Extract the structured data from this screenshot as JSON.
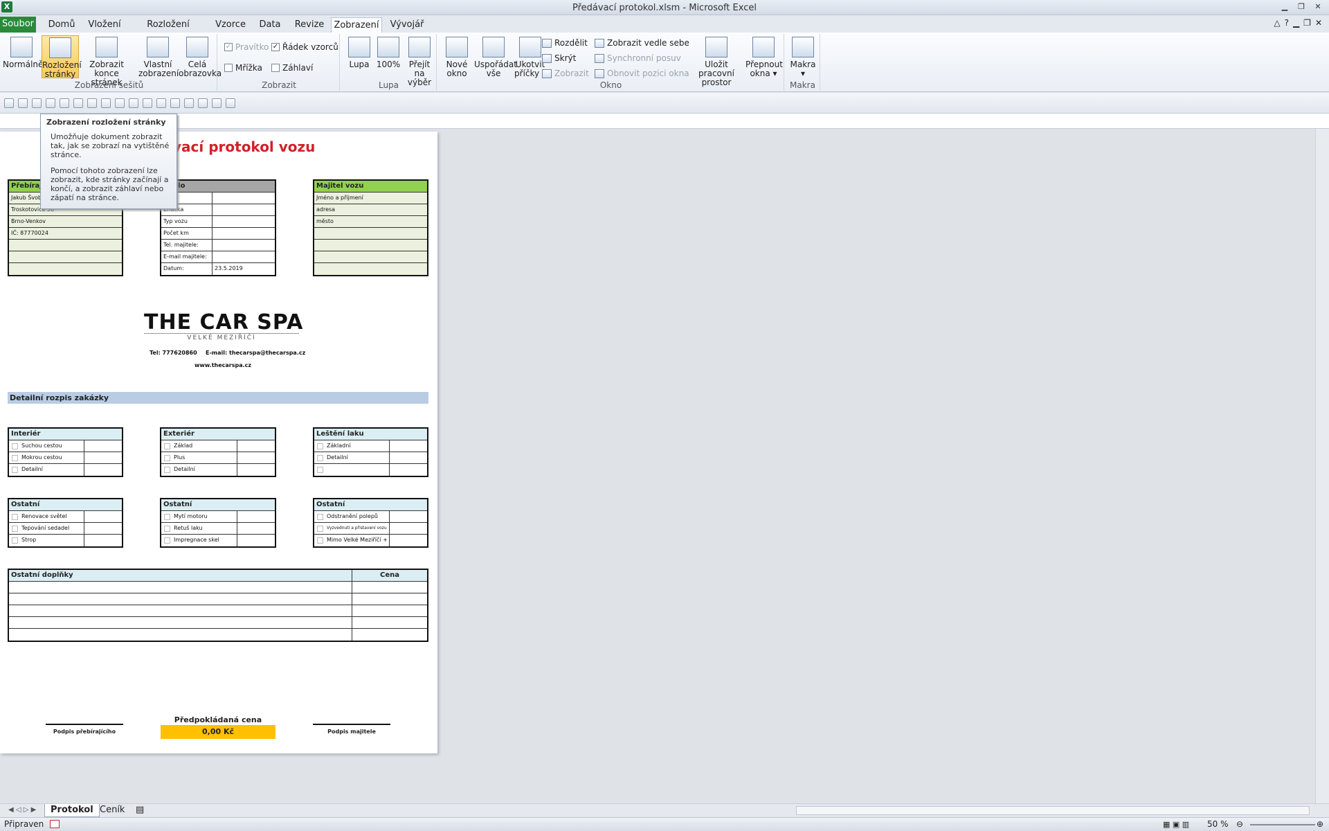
{
  "window": {
    "title": "Předávací protokol.xlsm - Microsoft Excel",
    "app_icon": "X"
  },
  "tabs": [
    "Soubor",
    "Domů",
    "Vložení",
    "Rozložení stránky",
    "Vzorce",
    "Data",
    "Revize",
    "Zobrazení",
    "Vývojář"
  ],
  "ribbon": {
    "workbook_views": {
      "label": "Zobrazení sešitů",
      "normal": "Normálně",
      "page_layout_1": "Rozložení",
      "page_layout_2": "stránky",
      "page_break_1": "Zobrazit",
      "page_break_2": "konce stránek",
      "custom_1": "Vlastní",
      "custom_2": "zobrazení",
      "full_1": "Celá",
      "full_2": "obrazovka"
    },
    "show": {
      "label": "Zobrazit",
      "ruler": "Pravítko",
      "formula_bar": "Řádek vzorců",
      "gridlines": "Mřížka",
      "headings": "Záhlaví"
    },
    "zoom": {
      "label": "Lupa",
      "zoom": "Lupa",
      "hundred": "100%",
      "sel_1": "Přejít na",
      "sel_2": "výběr"
    },
    "window": {
      "label": "Okno",
      "new_1": "Nové",
      "new_2": "okno",
      "arr_1": "Uspořádat",
      "arr_2": "vše",
      "freeze_1": "Ukotvit",
      "freeze_2": "příčky",
      "split": "Rozdělit",
      "hide": "Skrýt",
      "unhide": "Zobrazit",
      "side": "Zobrazit vedle sebe",
      "sync": "Synchronní posuv",
      "reset": "Obnovit pozici okna",
      "save_1": "Uložit pracovní",
      "save_2": "prostor",
      "switch_1": "Přepnout",
      "switch_2": "okna"
    },
    "macros": {
      "label": "Makra",
      "btn": "Makra"
    }
  },
  "tooltip": {
    "title": "Zobrazení rozložení stránky",
    "p1": "Umožňuje dokument zobrazit tak, jak se zobrazí na vytištěné stránce.",
    "p2": "Pomocí tohoto zobrazení lze zobrazit, kde stránky začínají a končí, a zobrazit záhlaví nebo zápatí na stránce."
  },
  "sheet": {
    "title": "vací protokol vozu",
    "receiver": {
      "header": "Přebírajíc",
      "rows": [
        "Jakub Švob",
        "Troskotovice 38",
        "Brno-Venkov",
        "IČ: 87770024",
        "",
        "",
        ""
      ]
    },
    "vehicle": {
      "header": "dlo",
      "rows": [
        [
          "",
          ""
        ],
        [
          "Značka",
          ""
        ],
        [
          "Typ vozu",
          ""
        ],
        [
          "Počet km",
          ""
        ],
        [
          "Tel. majitele:",
          ""
        ],
        [
          "E-mail majitele:",
          ""
        ],
        [
          "Datum:",
          "23.5.2019"
        ]
      ]
    },
    "owner": {
      "header": "Majitel vozu",
      "rows": [
        "Jméno a příjmení",
        "adresa",
        "město",
        "",
        "",
        "",
        ""
      ]
    },
    "logo": "THE CAR SPA",
    "logo_sub": "VELKÉ MEZIŘÍČÍ",
    "phone": "Tel: 777620860",
    "email": "E-mail: thecarspa@thecarspa.cz",
    "web": "www.thecarspa.cz",
    "detail_band": "Detailní rozpis zakázky",
    "interior": {
      "header": "Interiér",
      "rows": [
        "Suchou cestou",
        "Mokrou cestou",
        "Detailní"
      ]
    },
    "exterior": {
      "header": "Exteriér",
      "rows": [
        "Základ",
        "Plus",
        "Detailní"
      ]
    },
    "polish": {
      "header": "Leštění laku",
      "rows": [
        "Základní",
        "Detailní",
        ""
      ]
    },
    "other1": {
      "header": "Ostatní",
      "rows": [
        "Renovace světel",
        "Tepování sedadel",
        "Strop"
      ]
    },
    "other2": {
      "header": "Ostatní",
      "rows": [
        "Mytí motoru",
        "Retuš laku",
        "Impregnace skel"
      ]
    },
    "other3": {
      "header": "Ostatní",
      "rows": [
        "Odstranění polepů",
        "Vyzvednutí a přistavení vozu",
        "Mimo Velké Meziříčí +"
      ]
    },
    "extras": {
      "header": "Ostatní doplňky",
      "price_header": "Cena"
    },
    "sign_receiver": "Podpis přebírajícího",
    "sign_owner": "Podpis majitele",
    "expected_label": "Předpokládaná cena",
    "expected_value": "0,00 Kč"
  },
  "sheet_tabs": [
    "Protokol",
    "Ceník"
  ],
  "status": {
    "ready": "Připraven",
    "zoom": "50 %"
  }
}
